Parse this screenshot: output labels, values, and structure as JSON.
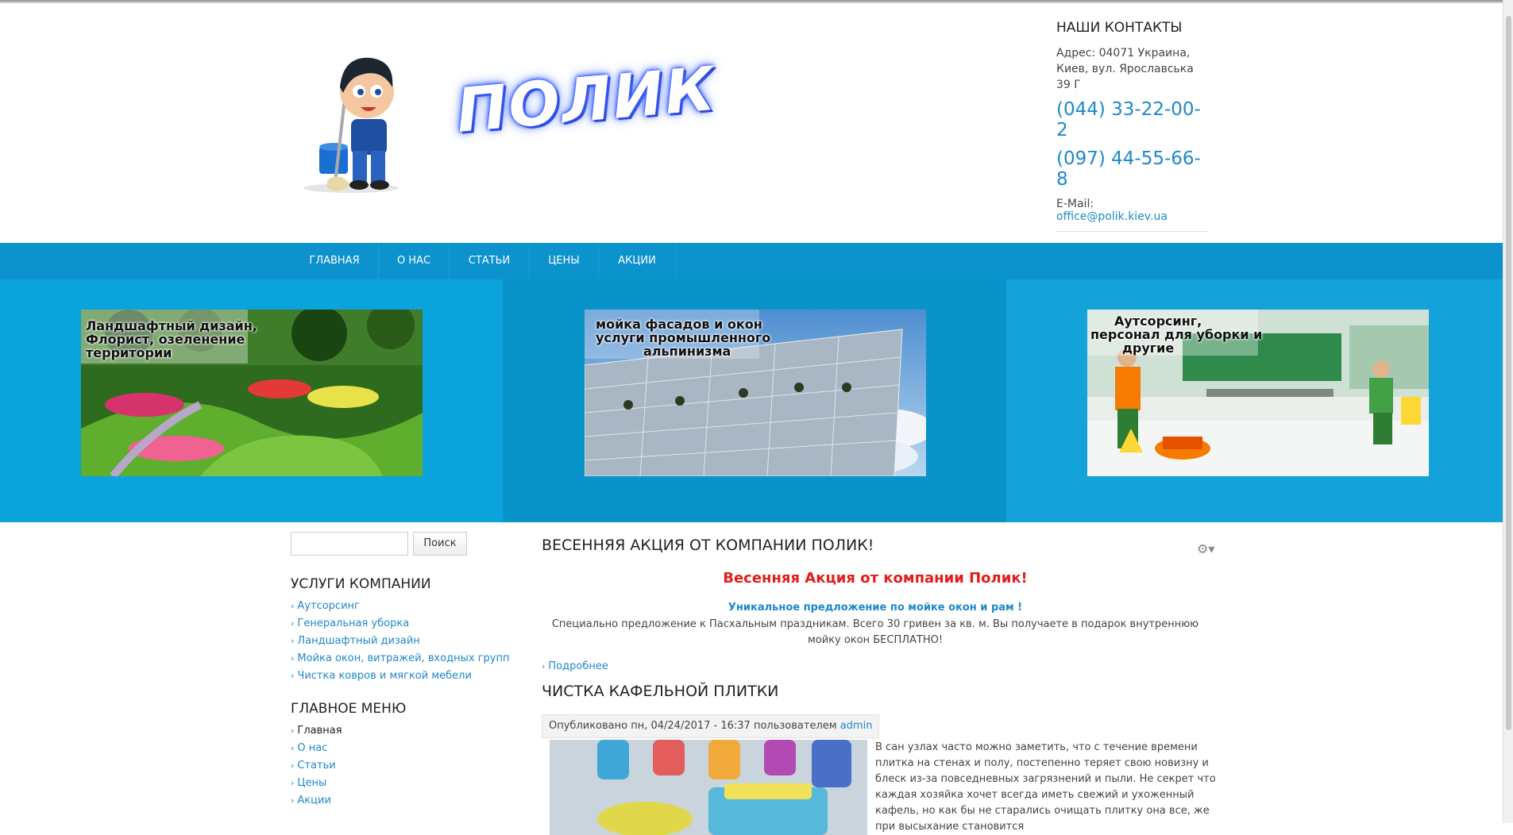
{
  "header": {
    "logo_text": "ПОЛИК",
    "contacts": {
      "title": "НАШИ КОНТАКТЫ",
      "address_line1": "Адрес:  04071  Украина,",
      "address_line2": "Киев, вул. Ярославська 39 Г",
      "phone1": "(044) 33-22-00-2",
      "phone2": "(097) 44-55-66-8",
      "email_label": "E-Mail: ",
      "email": "office@polik.kiev.ua"
    }
  },
  "nav": {
    "items": [
      "ГЛАВНАЯ",
      "О НАС",
      "СТАТЬИ",
      "ЦЕНЫ",
      "АКЦИИ"
    ]
  },
  "banners": [
    {
      "caption_l1": "Ландшафтный дизайн,",
      "caption_l2": "Флорист, озеленение",
      "caption_l3": "территории",
      "bg": "#0ba3dc"
    },
    {
      "caption_l1": "мойка фасадов и окон",
      "caption_l2": "услуги промышленного",
      "caption_l3": "альпинизма",
      "bg": "#0893c9"
    },
    {
      "caption_l1": "Аутсорсинг,",
      "caption_l2": "персонал для уборки и",
      "caption_l3": "другие",
      "bg": "#13a2d9"
    }
  ],
  "sidebar": {
    "search_button": "Поиск",
    "services_title": "УСЛУГИ КОМПАНИИ",
    "services": [
      "Аутсорсинг",
      "Генеральная уборка",
      "Ландшафтный дизайн",
      "Мойка окон, витражей, входных групп",
      "Чистка ковров и мягкой мебели"
    ],
    "menu_title": "ГЛАВНОЕ МЕНЮ",
    "menu": [
      "Главная",
      "О нас",
      "Статьи",
      "Цены",
      "Акции"
    ]
  },
  "main": {
    "article1_title": "ВЕСЕННЯЯ АКЦИЯ ОТ КОМПАНИИ ПОЛИК!",
    "promo_heading": "Весенняя Акция от компании Полик!",
    "promo_sub": "Уникальное предложение по мойке окон и рам !",
    "promo_body": "Специально предложение к Пасхальным праздникам. Всего 30 гривен за кв. м. Вы получаете в подарок внутреннюю мойку окон БЕСПЛАТНО!",
    "more": "Подробнее",
    "article2_title": "ЧИСТКА КАФЕЛЬНОЙ ПЛИТКИ",
    "meta_text": "Опубликовано пн, 04/24/2017 - 16:37 пользователем ",
    "meta_author": "admin",
    "article2_text": "В сан узлах часто можно заметить, что с течение времени плитка на стенах и полу, постепенно теряет свою новизну и блеск из-за повседневных загрязнений и пыли. Не секрет что каждая хозяйка хочет всегда иметь свежий и ухоженный кафель, но как бы не старались очищать плитку она все, же при высыхание становится"
  }
}
